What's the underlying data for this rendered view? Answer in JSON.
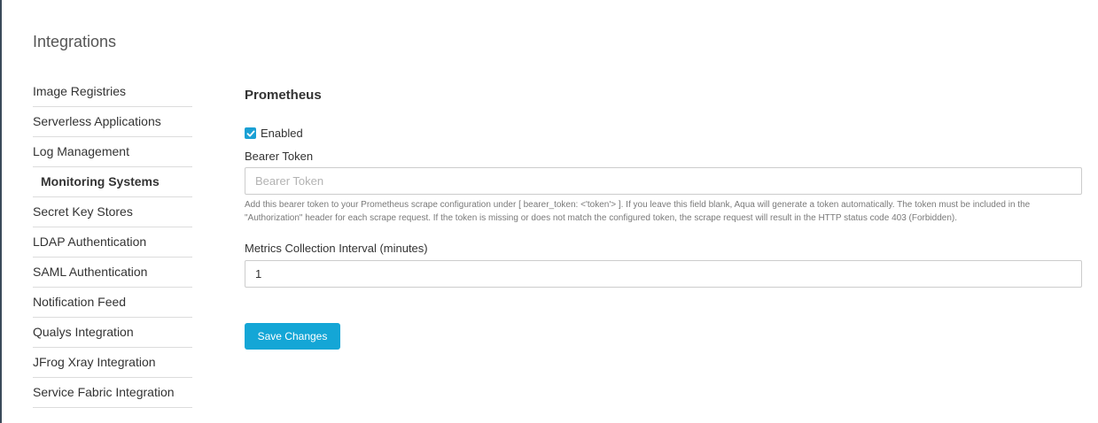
{
  "page": {
    "title": "Integrations"
  },
  "sidebar": {
    "items": [
      {
        "label": "Image Registries",
        "active": false
      },
      {
        "label": "Serverless Applications",
        "active": false
      },
      {
        "label": "Log Management",
        "active": false
      },
      {
        "label": "Monitoring Systems",
        "active": true
      },
      {
        "label": "Secret Key Stores",
        "active": false
      },
      {
        "label": "LDAP Authentication",
        "active": false
      },
      {
        "label": "SAML Authentication",
        "active": false
      },
      {
        "label": "Notification Feed",
        "active": false
      },
      {
        "label": "Qualys Integration",
        "active": false
      },
      {
        "label": "JFrog Xray Integration",
        "active": false
      },
      {
        "label": "Service Fabric Integration",
        "active": false
      }
    ]
  },
  "main": {
    "section_title": "Prometheus",
    "enabled": {
      "label": "Enabled",
      "checked": true
    },
    "bearer_token": {
      "label": "Bearer Token",
      "placeholder": "Bearer Token",
      "value": "",
      "help_text": "Add this bearer token to your Prometheus scrape configuration under [ bearer_token: <'token'> ]. If you leave this field blank, Aqua will generate a token automatically. The token must be included in the \"Authorization\" header for each scrape request. If the token is missing or does not match the configured token, the scrape request will result in the HTTP status code 403 (Forbidden)."
    },
    "interval": {
      "label": "Metrics Collection Interval (minutes)",
      "value": "1"
    },
    "save_label": "Save Changes"
  },
  "colors": {
    "accent": "#14a6d6",
    "checkbox": "#1aa0d4",
    "divider": "#dcdcdc"
  }
}
